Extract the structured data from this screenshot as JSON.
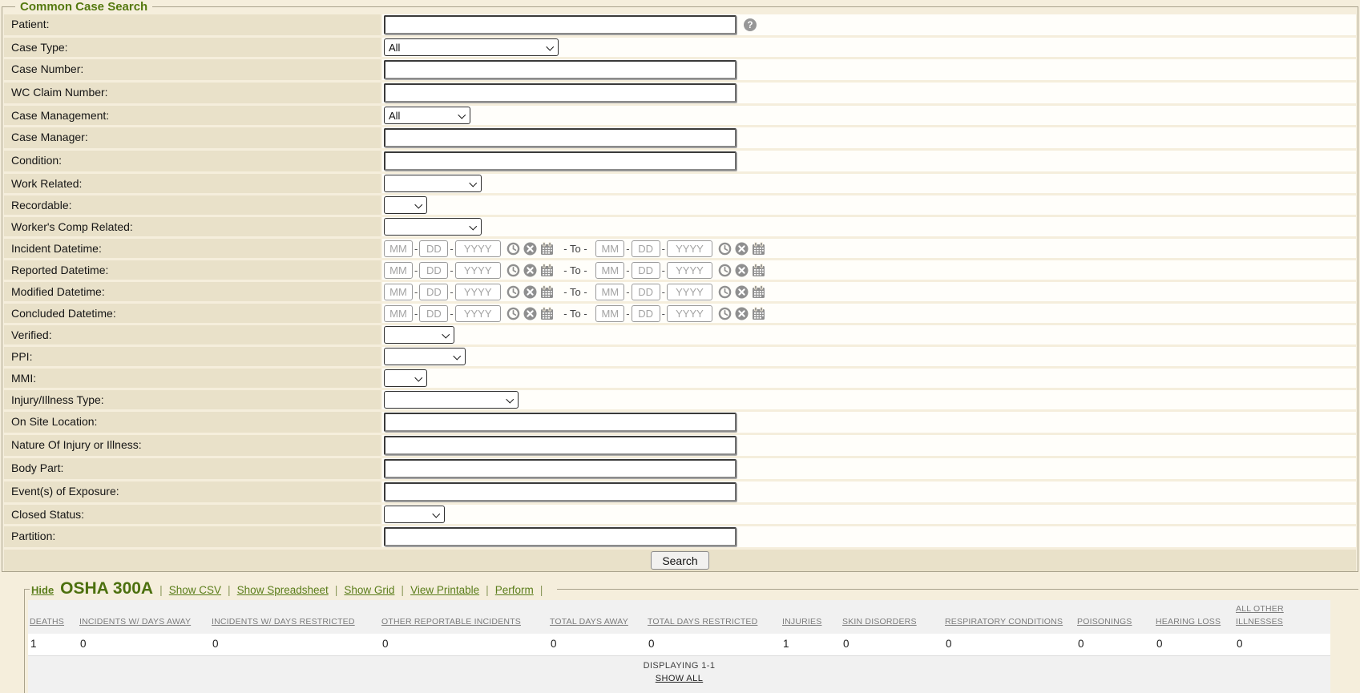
{
  "form": {
    "title": "Common Case Search",
    "rows": [
      {
        "name": "patient",
        "label": "Patient:",
        "type": "text",
        "value": "",
        "help_icon": true
      },
      {
        "name": "case-type",
        "label": "Case Type:",
        "type": "select",
        "value": "All"
      },
      {
        "name": "case-number",
        "label": "Case Number:",
        "type": "text",
        "value": ""
      },
      {
        "name": "wc-claim-number",
        "label": "WC Claim Number:",
        "type": "text",
        "value": ""
      },
      {
        "name": "case-management",
        "label": "Case Management:",
        "type": "select",
        "value": "All"
      },
      {
        "name": "case-manager",
        "label": "Case Manager:",
        "type": "text",
        "value": ""
      },
      {
        "name": "condition",
        "label": "Condition:",
        "type": "text",
        "value": ""
      },
      {
        "name": "work-related",
        "label": "Work Related:",
        "type": "select",
        "value": ""
      },
      {
        "name": "recordable",
        "label": "Recordable:",
        "type": "select",
        "value": ""
      },
      {
        "name": "workers-comp-related",
        "label": "Worker's Comp Related:",
        "type": "select",
        "value": ""
      },
      {
        "name": "incident-datetime",
        "label": "Incident Datetime:",
        "type": "daterange"
      },
      {
        "name": "reported-datetime",
        "label": "Reported Datetime:",
        "type": "daterange"
      },
      {
        "name": "modified-datetime",
        "label": "Modified Datetime:",
        "type": "daterange"
      },
      {
        "name": "concluded-datetime",
        "label": "Concluded Datetime:",
        "type": "daterange"
      },
      {
        "name": "verified",
        "label": "Verified:",
        "type": "select",
        "value": ""
      },
      {
        "name": "ppi",
        "label": "PPI:",
        "type": "select",
        "value": ""
      },
      {
        "name": "mmi",
        "label": "MMI:",
        "type": "select",
        "value": ""
      },
      {
        "name": "injury-illness-type",
        "label": "Injury/Illness Type:",
        "type": "select",
        "value": ""
      },
      {
        "name": "on-site-location",
        "label": "On Site Location:",
        "type": "text",
        "value": ""
      },
      {
        "name": "nature-of-injury-or-illness",
        "label": "Nature Of Injury or Illness:",
        "type": "text",
        "value": ""
      },
      {
        "name": "body-part",
        "label": "Body Part:",
        "type": "text",
        "value": ""
      },
      {
        "name": "events-of-exposure",
        "label": "Event(s) of Exposure:",
        "type": "text",
        "value": ""
      },
      {
        "name": "closed-status",
        "label": "Closed Status:",
        "type": "select",
        "value": ""
      },
      {
        "name": "partition",
        "label": "Partition:",
        "type": "text",
        "value": ""
      }
    ],
    "daterange": {
      "mm_placeholder": "MM",
      "dd_placeholder": "DD",
      "yyyy_placeholder": "YYYY",
      "to_label": "- To -",
      "icons": [
        "clock-icon",
        "clear-icon",
        "calendar-icon"
      ]
    },
    "help_icon": "help-icon",
    "search_button": "Search"
  },
  "osha": {
    "hide_link": "Hide",
    "title": "OSHA 300A",
    "separator": "|",
    "links": [
      "Show CSV",
      "Show Spreadsheet",
      "Show Grid",
      "View Printable",
      "Perform"
    ],
    "table": {
      "columns": [
        "DEATHS",
        "INCIDENTS W/ DAYS AWAY",
        "INCIDENTS W/ DAYS RESTRICTED",
        "OTHER REPORTABLE INCIDENTS",
        "TOTAL DAYS AWAY",
        "TOTAL DAYS RESTRICTED",
        "INJURIES",
        "SKIN DISORDERS",
        "RESPIRATORY CONDITIONS",
        "POISONINGS",
        "HEARING LOSS",
        "ALL OTHER ILLNESSES"
      ],
      "rows": [
        [
          "1",
          "0",
          "0",
          "0",
          "0",
          "0",
          "1",
          "0",
          "0",
          "0",
          "0",
          "0"
        ]
      ]
    },
    "footer": {
      "displaying": "DISPLAYING 1-1",
      "show_all": "SHOW ALL"
    }
  },
  "colors": {
    "accent_green": "#55790f",
    "link_green": "#5a7d1a",
    "label_beige": "#e9e1c9",
    "page_cream": "#f5eedc",
    "table_header_gray": "#7c7c7c",
    "icon_gray": "#8f8f8f"
  }
}
